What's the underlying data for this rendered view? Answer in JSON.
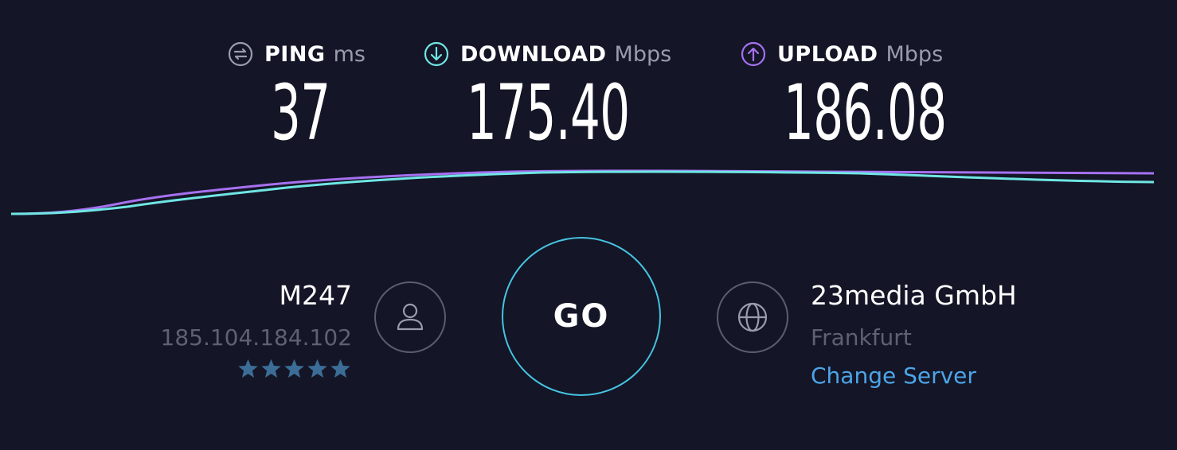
{
  "metrics": {
    "ping": {
      "label": "PING",
      "unit": "ms",
      "value": "37",
      "icon": "ping-icon"
    },
    "download": {
      "label": "DOWNLOAD",
      "unit": "Mbps",
      "value": "175.40",
      "icon": "download-arrow-icon"
    },
    "upload": {
      "label": "UPLOAD",
      "unit": "Mbps",
      "value": "186.08",
      "icon": "upload-arrow-icon"
    }
  },
  "client": {
    "isp": "M247",
    "ip": "185.104.184.102",
    "rating": 5,
    "rating_max": 5,
    "icon": "user-icon"
  },
  "go": {
    "label": "GO"
  },
  "server": {
    "name": "23media GmbH",
    "location": "Frankfurt",
    "change_label": "Change Server",
    "icon": "globe-icon"
  },
  "colors": {
    "background": "#141526",
    "download": "#6fe6e4",
    "upload": "#a671f0",
    "go_ring": "#45c4e0",
    "link": "#4ca5e8",
    "star": "#3b6d96",
    "muted": "#5f6172"
  }
}
